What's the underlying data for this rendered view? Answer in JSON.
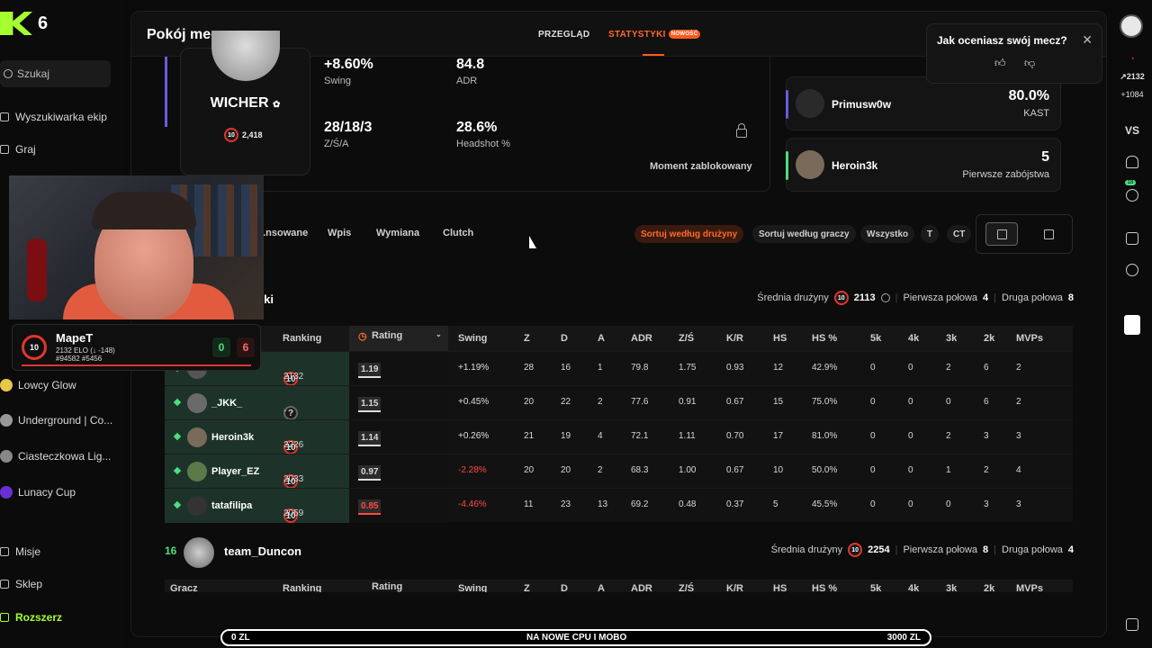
{
  "app": {
    "logo_number": "6"
  },
  "sidebar": {
    "search": "Szukaj",
    "items": [
      {
        "label": "Wyszukiwarka ekip"
      },
      {
        "label": "Graj"
      }
    ],
    "hubs": [
      {
        "label": "Lowcy Glow",
        "color": "#e8c64a"
      },
      {
        "label": "Underground | Co...",
        "color": "#999999"
      },
      {
        "label": "Ciasteczkowa Lig...",
        "color": "#888888"
      },
      {
        "label": "Lunacy Cup",
        "color": "#6b2fd6"
      }
    ],
    "bottom": [
      {
        "label": "Misje"
      },
      {
        "label": "Sklep"
      },
      {
        "label": "Rozszerz"
      }
    ]
  },
  "header": {
    "title": "Pokój meczowy",
    "tab_overview": "PRZEGLĄD",
    "tab_stats": "STATYSTYKI",
    "tab_stats_badge": "NOWOŚĆ"
  },
  "featured": {
    "name": "WICHER",
    "level": "10",
    "elo": "2,418",
    "stats": [
      {
        "value": "+8.60%",
        "label": "Swing"
      },
      {
        "value": "84.8",
        "label": "ADR"
      },
      {
        "value": "28/18/3",
        "label": "Z/Ś/A"
      },
      {
        "value": "28.6%",
        "label": "Headshot %"
      }
    ],
    "moment": "Moment zablokowany"
  },
  "highlights": [
    {
      "name": "Primusw0w",
      "value": "80.0%",
      "label": "KAST",
      "color": "#6a5ae0"
    },
    {
      "name": "Heroin3k",
      "value": "5",
      "label": "Pierwsze zabójstwa",
      "color": "#4ade80"
    }
  ],
  "filters": {
    "items": [
      "...nsowane",
      "Wpis",
      "Wymiana",
      "Clutch"
    ],
    "sort_team": "Sortuj według drużyny",
    "sort_players": "Sortuj według graczy",
    "all": "Wszystko",
    "t": "T",
    "ct": "CT"
  },
  "team1": {
    "name_partial": "wki",
    "avg_label": "Średnia drużyny",
    "avg_level": "10",
    "avg_elo": "2113",
    "first_half_label": "Pierwsza połowa",
    "first_half": "4",
    "second_half_label": "Druga połowa",
    "second_half": "8"
  },
  "table": {
    "headers": [
      "Ranking",
      "Rating",
      "Swing",
      "Z",
      "D",
      "A",
      "ADR",
      "Z/Ś",
      "K/R",
      "HS",
      "HS %",
      "5k",
      "4k",
      "3k",
      "2k",
      "MVPs"
    ],
    "rows": [
      {
        "name": "",
        "level": "10",
        "rank": "2132",
        "rating": "1.19",
        "swing": "+1.19%",
        "z": "28",
        "d": "16",
        "a": "1",
        "adr": "79.8",
        "zs": "1.75",
        "kr": "0.93",
        "hs": "12",
        "hsp": "42.9%",
        "k5": "0",
        "k4": "0",
        "k3": "2",
        "k2": "6",
        "mvp": "2",
        "neg": false
      },
      {
        "name": "_JKK_",
        "level": "?",
        "rank": "---",
        "rating": "1.15",
        "swing": "+0.45%",
        "z": "20",
        "d": "22",
        "a": "2",
        "adr": "77.6",
        "zs": "0.91",
        "kr": "0.67",
        "hs": "15",
        "hsp": "75.0%",
        "k5": "0",
        "k4": "0",
        "k3": "0",
        "k2": "6",
        "mvp": "2",
        "neg": false
      },
      {
        "name": "Heroin3k",
        "level": "10",
        "rank": "2226",
        "rating": "1.14",
        "swing": "+0.26%",
        "z": "21",
        "d": "19",
        "a": "4",
        "adr": "72.1",
        "zs": "1.11",
        "kr": "0.70",
        "hs": "17",
        "hsp": "81.0%",
        "k5": "0",
        "k4": "0",
        "k3": "2",
        "k2": "3",
        "mvp": "3",
        "neg": false
      },
      {
        "name": "Player_EZ",
        "level": "10",
        "rank": "2033",
        "rating": "0.97",
        "swing": "-2.28%",
        "z": "20",
        "d": "20",
        "a": "2",
        "adr": "68.3",
        "zs": "1.00",
        "kr": "0.67",
        "hs": "10",
        "hsp": "50.0%",
        "k5": "0",
        "k4": "0",
        "k3": "1",
        "k2": "2",
        "mvp": "4",
        "neg": true
      },
      {
        "name": "tatafilipa",
        "level": "10",
        "rank": "2059",
        "rating": "0.85",
        "swing": "-4.46%",
        "z": "11",
        "d": "23",
        "a": "13",
        "adr": "69.2",
        "zs": "0.48",
        "kr": "0.37",
        "hs": "5",
        "hsp": "45.5%",
        "k5": "0",
        "k4": "0",
        "k3": "0",
        "k2": "3",
        "mvp": "3",
        "neg": true
      }
    ]
  },
  "team2": {
    "score": "16",
    "name": "team_Duncon",
    "avg_label": "Średnia drużyny",
    "avg_level": "10",
    "avg_elo": "2254",
    "first_half_label": "Pierwsza połowa",
    "first_half": "8",
    "second_half_label": "Druga połowa",
    "second_half": "4",
    "header_partial": [
      "Gracz",
      "Ranking",
      "Rating",
      "Swing",
      "Z",
      "D",
      "A",
      "ADR",
      "Z/Ś",
      "K/R",
      "HS",
      "HS %",
      "5k",
      "4k",
      "3k",
      "2k",
      "MVPs"
    ]
  },
  "right_sidebar": {
    "elo": "2132",
    "elo_change": "+1084",
    "vs": "VS",
    "friends_count": "18"
  },
  "notification": {
    "title": "Jak oceniasz swój mecz?"
  },
  "streamer": {
    "level": "10",
    "name": "MapeT",
    "elo_line": "2132  ELO (↓ -148)",
    "ranks_line": "#94582  #5456",
    "wins": "0",
    "losses": "6"
  },
  "donation": {
    "left": "0 ZL",
    "center": "NA NOWE CPU I MOBO",
    "right": "3000 ZL"
  }
}
